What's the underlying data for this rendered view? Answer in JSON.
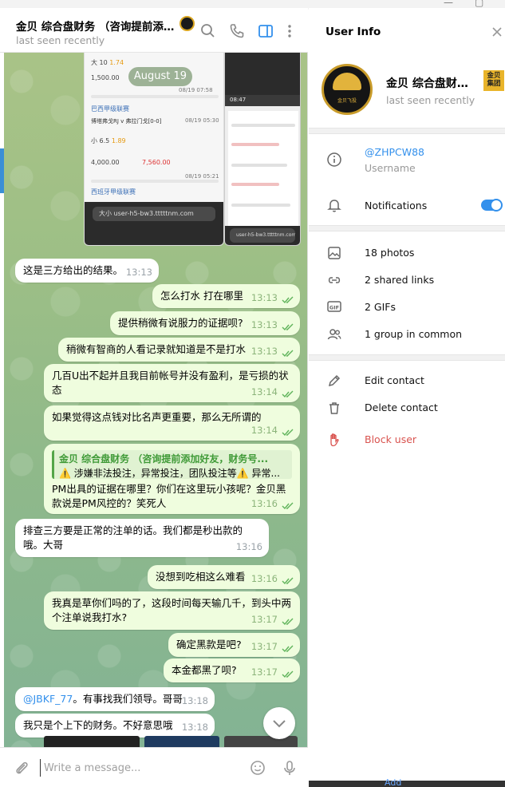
{
  "chat": {
    "title": "金贝 综合盘财务 （咨询提前添加...",
    "status": "last seen recently",
    "date_label": "August 19",
    "composer_placeholder": "Write a message...",
    "media_left": {
      "url": "user-h5-bw3.tttttnm.com",
      "label": "大小",
      "rows": [
        {
          "name": "大 10",
          "odds": "1.74"
        },
        {
          "name": "巴西甲级联赛",
          "odds": ""
        },
        {
          "name": "博塔弗戈RJ v 弗拉门戈[0-0]",
          "odds": ""
        },
        {
          "name": "小 6.5",
          "odds": "1.89"
        },
        {
          "name": "西班牙甲级联赛",
          "odds": ""
        }
      ],
      "amounts": [
        "1,500.00",
        "4,000.00",
        "7,560.00"
      ],
      "times": [
        "08/19 07:58",
        "08/19 05:30",
        "08/19 05:21"
      ]
    },
    "media_right": {
      "time": "08:47",
      "url": "user-h5-bw3.tttttnm.com"
    },
    "messages": [
      {
        "dir": "in",
        "text": "这是三方给出的结果。",
        "time": "13:13"
      },
      {
        "dir": "out",
        "text": "怎么打水 打在哪里",
        "time": "13:13"
      },
      {
        "dir": "out",
        "text": "提供稍微有说服力的证据呗?",
        "time": "13:13"
      },
      {
        "dir": "out",
        "text": "稍微有智商的人看记录就知道是不是打水",
        "time": "13:13"
      },
      {
        "dir": "out",
        "text": "几百U出不起并且我目前帐号并没有盈利，是亏损的状态",
        "time": "13:14"
      },
      {
        "dir": "out",
        "text": "如果觉得这点钱对比名声更重要，那么无所谓的",
        "time": "13:14"
      },
      {
        "dir": "out",
        "text": "PM出具的证据在哪里？你们在这里玩小孩呢？金贝黑款说是PM风控的？笑死人",
        "time": "13:16",
        "quote_title": "金贝 综合盘财务 （咨询提前添加好友，财务号...",
        "quote_body": "⚠️ 涉嫌非法投注，异常投注，团队投注等⚠️ 异常..."
      },
      {
        "dir": "in",
        "text": "排查三方要是正常的注单的话。我们都是秒出款的哦。大哥",
        "time": "13:16"
      },
      {
        "dir": "out",
        "text": "没想到吃相这么难看",
        "time": "13:16"
      },
      {
        "dir": "out",
        "text": "我真是草你们吗的了，这段时间每天输几千，到头中两个注单说我打水?",
        "time": "13:17"
      },
      {
        "dir": "out",
        "text": "确定黑款是吧?",
        "time": "13:17"
      },
      {
        "dir": "out",
        "text": "本金都黑了呗?",
        "time": "13:17"
      },
      {
        "dir": "in",
        "text": "@JBKF_77。有事找我们领导。哥哥",
        "mention": "@JBKF_77",
        "rest": "。有事找我们领导。哥哥",
        "time": "13:18"
      },
      {
        "dir": "in",
        "text": "我只是个上下的财务。不好意思哦",
        "time": "13:18"
      }
    ]
  },
  "info": {
    "title": "User Info",
    "name": "金贝 综合盘财务...",
    "status": "last seen recently",
    "badge": "金贝集团",
    "avatar_text": "金贝飞投",
    "username": "@ZHPCW88",
    "username_label": "Username",
    "notifications_label": "Notifications",
    "notifications_on": true,
    "media": [
      {
        "icon": "photo-icon",
        "label": "18 photos"
      },
      {
        "icon": "link-icon",
        "label": "2 shared links"
      },
      {
        "icon": "gif-icon",
        "label": "2 GIFs"
      },
      {
        "icon": "group-icon",
        "label": "1 group in common"
      }
    ],
    "actions": [
      {
        "icon": "pencil-icon",
        "label": "Edit contact"
      },
      {
        "icon": "trash-icon",
        "label": "Delete contact"
      },
      {
        "icon": "hand-stop-icon",
        "label": "Block user"
      }
    ],
    "taskbar_label": "Add"
  },
  "colors": {
    "accent": "#3390ec",
    "danger": "#d9534f",
    "outgoing": "#effdde",
    "quote": "#53a548"
  }
}
